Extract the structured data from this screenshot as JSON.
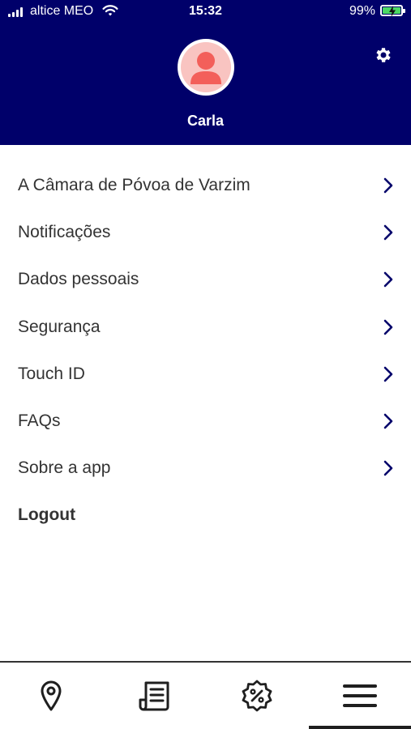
{
  "status_bar": {
    "carrier": "altice MEO",
    "time": "15:32",
    "battery": "99%",
    "battery_level": 0.99,
    "wifi_icon": "wifi-icon",
    "signal_icon": "signal-icon"
  },
  "header": {
    "user_name": "Carla",
    "avatar_icon": "user-avatar-icon",
    "settings_icon": "gear-icon",
    "background_color": "#00006a"
  },
  "menu": {
    "items": [
      {
        "label": "A Câmara de Póvoa de Varzim"
      },
      {
        "label": "Notificações"
      },
      {
        "label": "Dados pessoais"
      },
      {
        "label": "Segurança"
      },
      {
        "label": "Touch ID"
      },
      {
        "label": "FAQs"
      },
      {
        "label": "Sobre a app"
      }
    ],
    "logout": "Logout",
    "chevron_color": "#00006a"
  },
  "tabbar": {
    "tabs": [
      {
        "icon": "location-pin-icon"
      },
      {
        "icon": "document-icon"
      },
      {
        "icon": "discount-badge-icon"
      },
      {
        "icon": "menu-icon",
        "active": true
      }
    ]
  }
}
